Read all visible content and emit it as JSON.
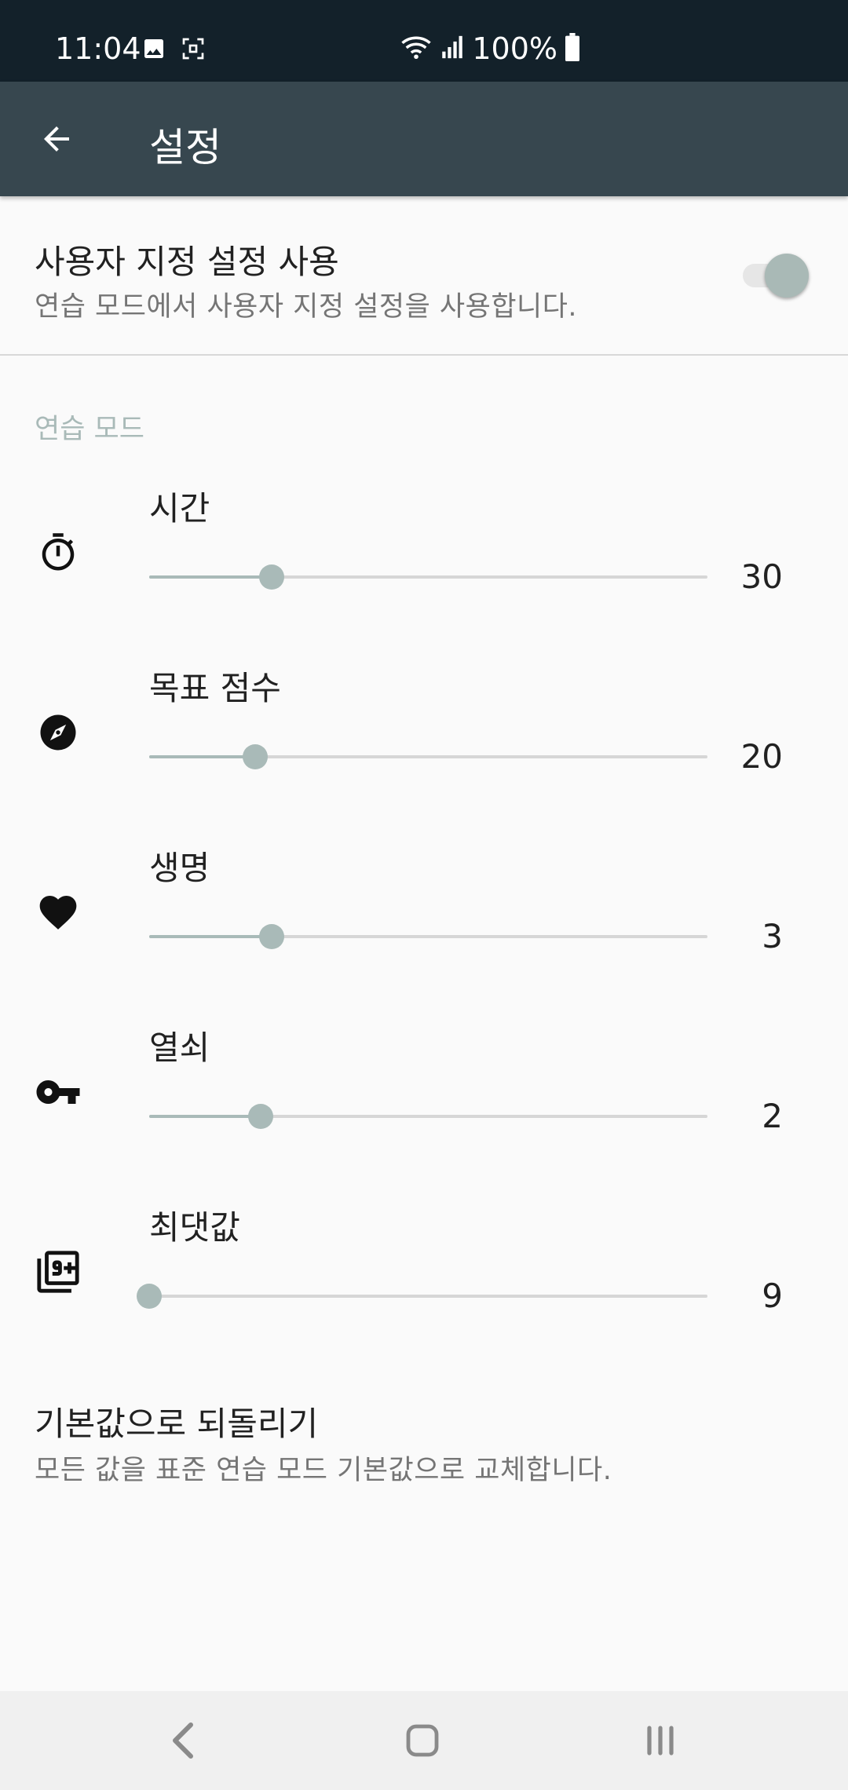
{
  "status_bar": {
    "time": "11:04",
    "battery_percent": "100%",
    "icons": [
      "image-icon",
      "screenshot-icon",
      "wifi-icon",
      "signal-icon",
      "battery-icon"
    ]
  },
  "app_bar": {
    "title": "설정",
    "back_icon": "arrow-back-icon"
  },
  "custom_settings": {
    "title": "사용자 지정 설정 사용",
    "summary": "연습 모드에서 사용자 지정 설정을 사용합니다.",
    "enabled": true
  },
  "category": {
    "title": "연습 모드"
  },
  "sliders": [
    {
      "label": "시간",
      "value": "30",
      "icon": "timer-icon",
      "fraction": 0.22
    },
    {
      "label": "목표 점수",
      "value": "20",
      "icon": "compass-icon",
      "fraction": 0.19
    },
    {
      "label": "생명",
      "value": "3",
      "icon": "heart-icon",
      "fraction": 0.22
    },
    {
      "label": "열쇠",
      "value": "2",
      "icon": "key-icon",
      "fraction": 0.2
    },
    {
      "label": "최댓값",
      "value": "9",
      "icon": "filter-9-plus-icon",
      "fraction": 0.0
    }
  ],
  "reset": {
    "title": "기본값으로 되돌리기",
    "summary": "모든 값을 표준 연습 모드 기본값으로 교체합니다."
  },
  "nav_bar": {
    "icons": [
      "nav-back-icon",
      "nav-home-icon",
      "nav-recents-icon"
    ]
  },
  "colors": {
    "status_bar": "#13212a",
    "app_bar": "#37474f",
    "accent": "#a9bab8",
    "background": "#fafafa"
  }
}
